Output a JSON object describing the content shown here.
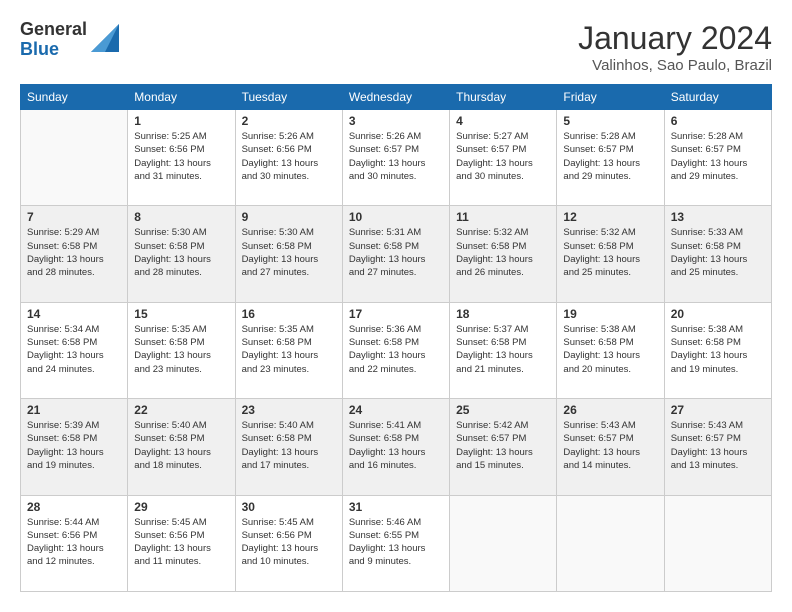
{
  "header": {
    "logo_general": "General",
    "logo_blue": "Blue",
    "month_title": "January 2024",
    "location": "Valinhos, Sao Paulo, Brazil"
  },
  "days_of_week": [
    "Sunday",
    "Monday",
    "Tuesday",
    "Wednesday",
    "Thursday",
    "Friday",
    "Saturday"
  ],
  "weeks": [
    [
      {
        "day": "",
        "info": ""
      },
      {
        "day": "1",
        "info": "Sunrise: 5:25 AM\nSunset: 6:56 PM\nDaylight: 13 hours\nand 31 minutes."
      },
      {
        "day": "2",
        "info": "Sunrise: 5:26 AM\nSunset: 6:56 PM\nDaylight: 13 hours\nand 30 minutes."
      },
      {
        "day": "3",
        "info": "Sunrise: 5:26 AM\nSunset: 6:57 PM\nDaylight: 13 hours\nand 30 minutes."
      },
      {
        "day": "4",
        "info": "Sunrise: 5:27 AM\nSunset: 6:57 PM\nDaylight: 13 hours\nand 30 minutes."
      },
      {
        "day": "5",
        "info": "Sunrise: 5:28 AM\nSunset: 6:57 PM\nDaylight: 13 hours\nand 29 minutes."
      },
      {
        "day": "6",
        "info": "Sunrise: 5:28 AM\nSunset: 6:57 PM\nDaylight: 13 hours\nand 29 minutes."
      }
    ],
    [
      {
        "day": "7",
        "info": "Sunrise: 5:29 AM\nSunset: 6:58 PM\nDaylight: 13 hours\nand 28 minutes."
      },
      {
        "day": "8",
        "info": "Sunrise: 5:30 AM\nSunset: 6:58 PM\nDaylight: 13 hours\nand 28 minutes."
      },
      {
        "day": "9",
        "info": "Sunrise: 5:30 AM\nSunset: 6:58 PM\nDaylight: 13 hours\nand 27 minutes."
      },
      {
        "day": "10",
        "info": "Sunrise: 5:31 AM\nSunset: 6:58 PM\nDaylight: 13 hours\nand 27 minutes."
      },
      {
        "day": "11",
        "info": "Sunrise: 5:32 AM\nSunset: 6:58 PM\nDaylight: 13 hours\nand 26 minutes."
      },
      {
        "day": "12",
        "info": "Sunrise: 5:32 AM\nSunset: 6:58 PM\nDaylight: 13 hours\nand 25 minutes."
      },
      {
        "day": "13",
        "info": "Sunrise: 5:33 AM\nSunset: 6:58 PM\nDaylight: 13 hours\nand 25 minutes."
      }
    ],
    [
      {
        "day": "14",
        "info": "Sunrise: 5:34 AM\nSunset: 6:58 PM\nDaylight: 13 hours\nand 24 minutes."
      },
      {
        "day": "15",
        "info": "Sunrise: 5:35 AM\nSunset: 6:58 PM\nDaylight: 13 hours\nand 23 minutes."
      },
      {
        "day": "16",
        "info": "Sunrise: 5:35 AM\nSunset: 6:58 PM\nDaylight: 13 hours\nand 23 minutes."
      },
      {
        "day": "17",
        "info": "Sunrise: 5:36 AM\nSunset: 6:58 PM\nDaylight: 13 hours\nand 22 minutes."
      },
      {
        "day": "18",
        "info": "Sunrise: 5:37 AM\nSunset: 6:58 PM\nDaylight: 13 hours\nand 21 minutes."
      },
      {
        "day": "19",
        "info": "Sunrise: 5:38 AM\nSunset: 6:58 PM\nDaylight: 13 hours\nand 20 minutes."
      },
      {
        "day": "20",
        "info": "Sunrise: 5:38 AM\nSunset: 6:58 PM\nDaylight: 13 hours\nand 19 minutes."
      }
    ],
    [
      {
        "day": "21",
        "info": "Sunrise: 5:39 AM\nSunset: 6:58 PM\nDaylight: 13 hours\nand 19 minutes."
      },
      {
        "day": "22",
        "info": "Sunrise: 5:40 AM\nSunset: 6:58 PM\nDaylight: 13 hours\nand 18 minutes."
      },
      {
        "day": "23",
        "info": "Sunrise: 5:40 AM\nSunset: 6:58 PM\nDaylight: 13 hours\nand 17 minutes."
      },
      {
        "day": "24",
        "info": "Sunrise: 5:41 AM\nSunset: 6:58 PM\nDaylight: 13 hours\nand 16 minutes."
      },
      {
        "day": "25",
        "info": "Sunrise: 5:42 AM\nSunset: 6:57 PM\nDaylight: 13 hours\nand 15 minutes."
      },
      {
        "day": "26",
        "info": "Sunrise: 5:43 AM\nSunset: 6:57 PM\nDaylight: 13 hours\nand 14 minutes."
      },
      {
        "day": "27",
        "info": "Sunrise: 5:43 AM\nSunset: 6:57 PM\nDaylight: 13 hours\nand 13 minutes."
      }
    ],
    [
      {
        "day": "28",
        "info": "Sunrise: 5:44 AM\nSunset: 6:56 PM\nDaylight: 13 hours\nand 12 minutes."
      },
      {
        "day": "29",
        "info": "Sunrise: 5:45 AM\nSunset: 6:56 PM\nDaylight: 13 hours\nand 11 minutes."
      },
      {
        "day": "30",
        "info": "Sunrise: 5:45 AM\nSunset: 6:56 PM\nDaylight: 13 hours\nand 10 minutes."
      },
      {
        "day": "31",
        "info": "Sunrise: 5:46 AM\nSunset: 6:55 PM\nDaylight: 13 hours\nand 9 minutes."
      },
      {
        "day": "",
        "info": ""
      },
      {
        "day": "",
        "info": ""
      },
      {
        "day": "",
        "info": ""
      }
    ]
  ]
}
